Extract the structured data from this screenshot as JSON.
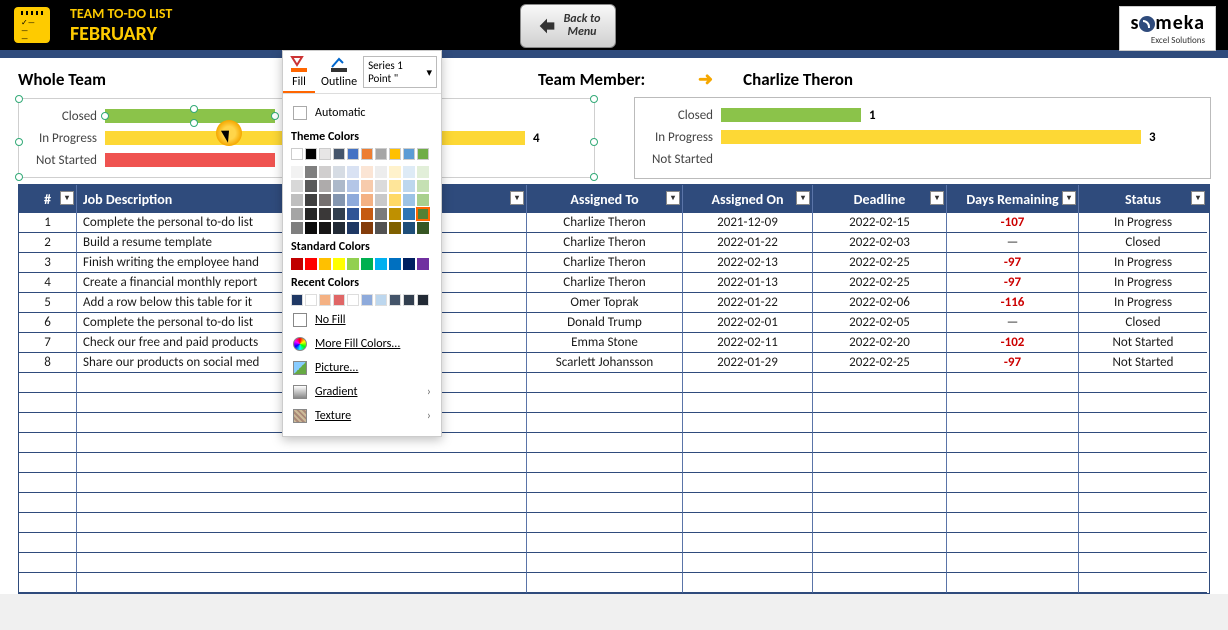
{
  "header": {
    "title": "TEAM TO-DO LIST",
    "month": "FEBRUARY",
    "back": "Back to\nMenu",
    "logo": "someka",
    "logo_sub": "Excel Solutions"
  },
  "whole_team_label": "Whole Team",
  "team_member_label": "Team Member:",
  "team_member_name": "Charlize Theron",
  "chart_data": [
    {
      "type": "bar",
      "title": "Whole Team",
      "categories": [
        "Closed",
        "In Progress",
        "Not Started"
      ],
      "values": [
        2,
        4,
        2
      ],
      "colors": [
        "#8bc34a",
        "#fdd835",
        "#ef5350"
      ],
      "xlim": [
        0,
        8
      ]
    },
    {
      "type": "bar",
      "title": "Charlize Theron",
      "categories": [
        "Closed",
        "In Progress",
        "Not Started"
      ],
      "values": [
        1,
        3,
        0
      ],
      "colors": [
        "#8bc34a",
        "#fdd835",
        "#ef5350"
      ],
      "xlim": [
        0,
        3
      ]
    }
  ],
  "labels": {
    "closed": "Closed",
    "inprog": "In Progress",
    "notstart": "Not Started"
  },
  "team_vals": {
    "inprog": "4"
  },
  "member_vals": {
    "closed": "1",
    "inprog": "3"
  },
  "columns": {
    "num": "#",
    "desc": "Job Description",
    "assigned": "Assigned To",
    "on": "Assigned On",
    "dead": "Deadline",
    "days": "Days Remaining",
    "status": "Status"
  },
  "rows": [
    {
      "n": "1",
      "d": "Complete the personal to-do list",
      "a": "Charlize Theron",
      "o": "2021-12-09",
      "dl": "2022-02-15",
      "dr": "-107",
      "s": "In Progress"
    },
    {
      "n": "2",
      "d": "Build a resume template",
      "a": "Charlize Theron",
      "o": "2022-01-22",
      "dl": "2022-02-03",
      "dr": "—",
      "s": "Closed"
    },
    {
      "n": "3",
      "d": "Finish writing the employee hand",
      "a": "Charlize Theron",
      "o": "2022-02-13",
      "dl": "2022-02-25",
      "dr": "-97",
      "s": "In Progress"
    },
    {
      "n": "4",
      "d": "Create a financial monthly report",
      "a": "Charlize Theron",
      "o": "2022-01-13",
      "dl": "2022-02-25",
      "dr": "-97",
      "s": "In Progress"
    },
    {
      "n": "5",
      "d": "Add a row below this table for it",
      "a": "Omer Toprak",
      "o": "2022-01-22",
      "dl": "2022-02-06",
      "dr": "-116",
      "s": "In Progress"
    },
    {
      "n": "6",
      "d": "Complete the personal to-do list",
      "a": "Donald Trump",
      "o": "2022-02-01",
      "dl": "2022-02-05",
      "dr": "—",
      "s": "Closed"
    },
    {
      "n": "7",
      "d": "Check our free and paid products",
      "a": "Emma Stone",
      "o": "2022-02-11",
      "dl": "2022-02-20",
      "dr": "-102",
      "s": "Not Started"
    },
    {
      "n": "8",
      "d": "Share our products on social med",
      "a": "Scarlett Johansson",
      "o": "2022-01-29",
      "dl": "2022-02-25",
      "dr": "-97",
      "s": "Not Started"
    }
  ],
  "popup": {
    "fill": "Fill",
    "outline": "Outline",
    "series": "Series 1 Point \"",
    "auto": "Automatic",
    "theme": "Theme Colors",
    "standard": "Standard Colors",
    "recent": "Recent Colors",
    "nofill": "No Fill",
    "more": "More Fill Colors...",
    "picture": "Picture...",
    "gradient": "Gradient",
    "texture": "Texture"
  },
  "theme_row1": [
    "#ffffff",
    "#000000",
    "#e7e6e6",
    "#44546a",
    "#4472c4",
    "#ed7d31",
    "#a5a5a5",
    "#ffc000",
    "#5b9bd5",
    "#70ad47"
  ],
  "theme_grid": [
    [
      "#f2f2f2",
      "#7f7f7f",
      "#d0cece",
      "#d6dce4",
      "#d9e2f3",
      "#fbe5d5",
      "#ededed",
      "#fff2cc",
      "#deebf6",
      "#e2efd9"
    ],
    [
      "#d8d8d8",
      "#595959",
      "#aeabab",
      "#adb9ca",
      "#b4c6e7",
      "#f7cbac",
      "#dbdbdb",
      "#fee599",
      "#bdd7ee",
      "#c5e0b3"
    ],
    [
      "#bfbfbf",
      "#3f3f3f",
      "#757070",
      "#8496b0",
      "#8eaadb",
      "#f4b183",
      "#c9c9c9",
      "#ffd965",
      "#9cc3e5",
      "#a8d08d"
    ],
    [
      "#a5a5a5",
      "#262626",
      "#3a3838",
      "#323f4f",
      "#2f5496",
      "#c55a11",
      "#7b7b7b",
      "#bf9000",
      "#2e75b5",
      "#538135"
    ],
    [
      "#7f7f7f",
      "#0c0c0c",
      "#171616",
      "#222a35",
      "#1f3864",
      "#833c0b",
      "#525252",
      "#7f6000",
      "#1e4e79",
      "#375623"
    ]
  ],
  "standard_row": [
    "#c00000",
    "#ff0000",
    "#ffc000",
    "#ffff00",
    "#92d050",
    "#00b050",
    "#00b0f0",
    "#0070c0",
    "#002060",
    "#7030a0"
  ],
  "recent_row": [
    "#1f3864",
    "#ffffff",
    "#f4b183",
    "#e06666",
    "#ffffff",
    "#8eaadb",
    "#bdd7ee",
    "#44546a",
    "#323f4f",
    "#222a35"
  ]
}
